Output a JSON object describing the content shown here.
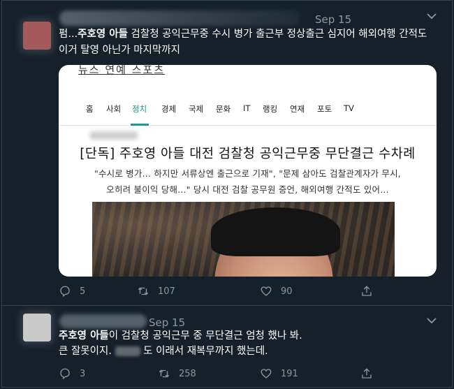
{
  "tweet1": {
    "date": "Sep 15",
    "text_prefix": "펌...",
    "text_bold": "주호영 아들",
    "text_line1_rest": " 검찰청 공익근무중 수시 병가 출근부 정상출근 심지어 해외여행 간적도",
    "text_line2": "이거 탈영 아닌가 마지막까지",
    "card": {
      "top_text": "뉴스 연예 스포츠",
      "nav": [
        "홈",
        "사회",
        "정치",
        "경제",
        "국제",
        "문화",
        "IT",
        "랭킹",
        "연재",
        "포토",
        "TV"
      ],
      "active_nav": "정치",
      "headline": "[단독] 주호영 아들 대전 검찰청 공익근무중 무단결근 수차례",
      "sub_line1": "\"수시로 병가... 하지만 서류상엔 출근으로 기재\", \"문제 삼아도 검찰관계자가 무시,",
      "sub_line2": "오히려 불이익 당해...\"  당시 대전 검찰 공무원 증언, 해외여행 간적도 있어..."
    },
    "actions": {
      "replies": "5",
      "retweets": "107",
      "likes": "90"
    }
  },
  "tweet2": {
    "date": "Sep 15",
    "text_bold": "주호영 아들",
    "text_line1_rest": "이 검찰청 공익근무 중 무단결근 엄청 했나 봐.",
    "text_line2_a": "큰 잘못이지.",
    "text_line2_b": "도 이래서 재복무까지 했는데.",
    "actions": {
      "replies": "3",
      "retweets": "258",
      "likes": "191"
    }
  },
  "icons": [
    "reply-icon",
    "retweet-icon",
    "like-icon",
    "share-icon",
    "chevron-down-icon"
  ],
  "colors": {
    "background": "#15202b",
    "muted": "#8899a6",
    "border": "#38444d",
    "accent_nav": "#1a9c8f"
  }
}
